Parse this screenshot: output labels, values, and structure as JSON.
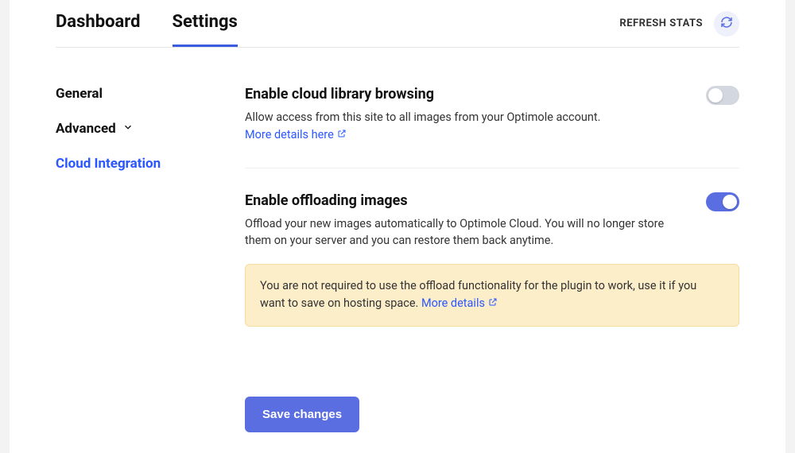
{
  "topbar": {
    "tabs": [
      {
        "label": "Dashboard",
        "active": false
      },
      {
        "label": "Settings",
        "active": true
      }
    ],
    "refresh_label": "REFRESH STATS"
  },
  "sidebar": {
    "items": [
      {
        "label": "General",
        "active": false,
        "expandable": false
      },
      {
        "label": "Advanced",
        "active": false,
        "expandable": true
      },
      {
        "label": "Cloud Integration",
        "active": true,
        "expandable": false
      }
    ]
  },
  "settings": {
    "cloud_library": {
      "title": "Enable cloud library browsing",
      "desc": "Allow access from this site to all images from your Optimole account.",
      "link_label": "More details here",
      "on": false
    },
    "offload": {
      "title": "Enable offloading images",
      "desc": "Offload your new images automatically to Optimole Cloud. You will no longer store them on your server and you can restore them back anytime.",
      "on": true,
      "notice_text": "You are not required to use the offload functionality for the plugin to work, use it if you want to save on hosting space.",
      "notice_link_label": "More details"
    }
  },
  "actions": {
    "save_label": "Save changes"
  }
}
